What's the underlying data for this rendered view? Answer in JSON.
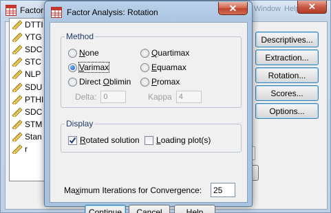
{
  "background_window": {
    "title": "Factor A",
    "ghost_menu": [
      "Window",
      "Help"
    ],
    "variables": [
      "DTTI",
      "YTG",
      "SDC",
      "STC",
      "NLP",
      "SDU",
      "PTHI",
      "SDC",
      "STM",
      "Stan",
      "r"
    ],
    "buttons": [
      {
        "label": "Descriptives...",
        "underline": "D"
      },
      {
        "label": "Extraction...",
        "underline": "E"
      },
      {
        "label": "Rotation...",
        "underline": "t"
      },
      {
        "label": "Scores...",
        "underline": "S"
      },
      {
        "label": "Options...",
        "underline": "O"
      }
    ]
  },
  "dialog": {
    "title": "Factor Analysis: Rotation",
    "method": {
      "legend": "Method",
      "options": [
        {
          "label": "None",
          "selected": false
        },
        {
          "label": "Quartimax",
          "selected": false
        },
        {
          "label": "Varimax",
          "selected": true
        },
        {
          "label": "Equamax",
          "selected": false
        },
        {
          "label": "Direct Oblimin",
          "selected": false
        },
        {
          "label": "Promax",
          "selected": false
        }
      ],
      "delta": {
        "label": "Delta:",
        "value": "0"
      },
      "kappa": {
        "label": "Kappa",
        "value": "4"
      }
    },
    "display": {
      "legend": "Display",
      "rotated_solution": {
        "label": "Rotated solution",
        "checked": true
      },
      "loading_plots": {
        "label": "Loading plot(s)",
        "checked": false
      }
    },
    "max_iterations": {
      "label": "Maximum Iterations for Convergence:",
      "value": "25"
    },
    "buttons": {
      "continue": "Continue",
      "cancel": "Cancel",
      "help": "Help"
    }
  },
  "colors": {
    "accent": "#3c7fb1",
    "legend": "#1e3a6e",
    "close": "#c75b46"
  }
}
